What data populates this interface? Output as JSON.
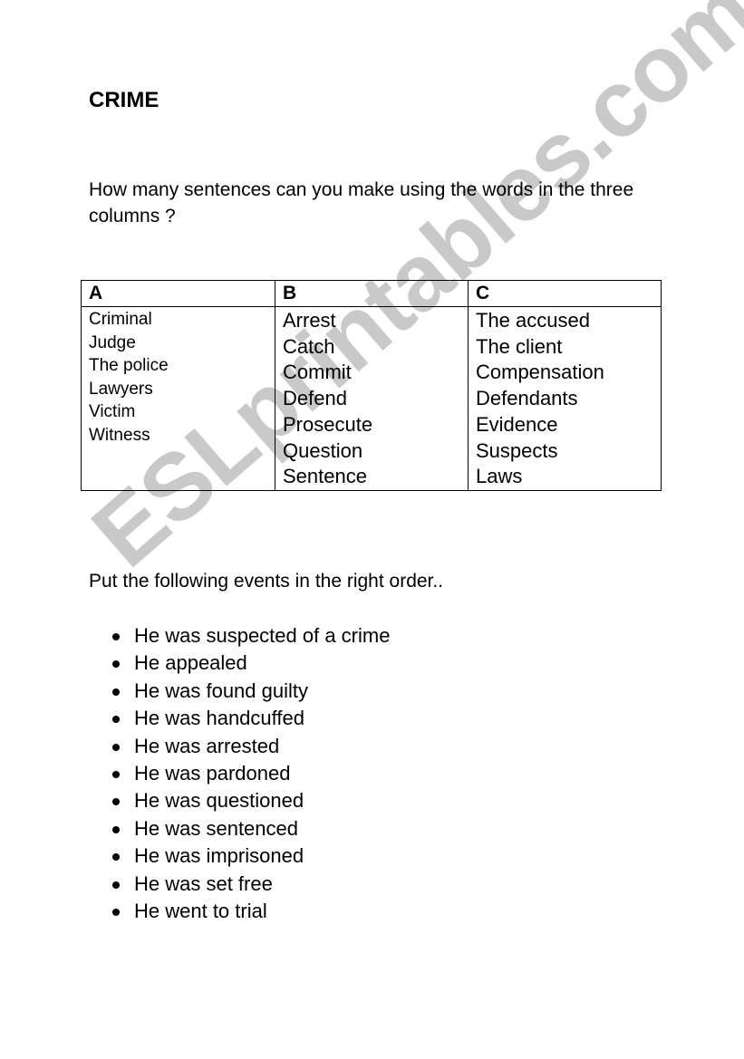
{
  "watermark": "ESLprintables.com",
  "title": "CRIME",
  "exercise1": {
    "instruction": "How many sentences can you make using the words in the three columns ?",
    "columns": [
      {
        "header": "A",
        "words": [
          "Criminal",
          "Judge",
          "The police",
          "Lawyers",
          "Victim",
          "Witness"
        ]
      },
      {
        "header": "B",
        "words": [
          "Arrest",
          "Catch",
          "Commit",
          "Defend",
          "Prosecute",
          "Question",
          "Sentence"
        ]
      },
      {
        "header": "C",
        "words": [
          "The accused",
          "The client",
          "Compensation",
          "Defendants",
          "Evidence",
          "Suspects",
          "Laws"
        ]
      }
    ]
  },
  "exercise2": {
    "instruction": "Put the following events in the right order..",
    "events": [
      "He was suspected of a crime",
      "He appealed",
      "He was found guilty",
      "He was handcuffed",
      "He was arrested",
      "He was pardoned",
      "He was questioned",
      "He was sentenced",
      "He was imprisoned",
      "He was set free",
      "He went to trial"
    ]
  }
}
